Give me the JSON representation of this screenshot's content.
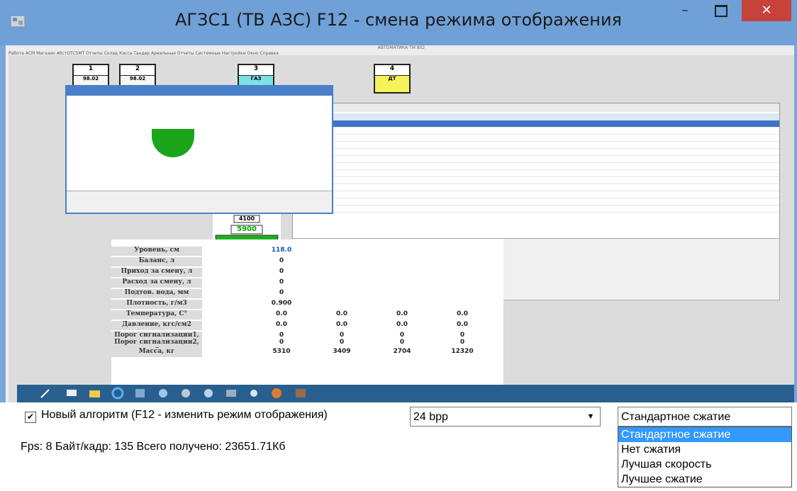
{
  "window": {
    "title": "АГЗС1 (ТВ АЗС) F12 - смена режима отображения",
    "minimize": "–",
    "close": "✕",
    "accent": "#6fa0d8",
    "close_color": "#c7423a"
  },
  "remote": {
    "app_title": "АВТОМАТИКА ТМ 802",
    "menu": "Работа АСМ Магазин АбстOTCSMT Отчеты Склад Касса Тандер Ареальные Отчеты Системные Настройки Окно Справка",
    "dispensers": [
      {
        "num": "1",
        "fuel": "98.02"
      },
      {
        "num": "2",
        "fuel": "98.02"
      },
      {
        "num": "3",
        "fuel": "ГАЗ"
      },
      {
        "num": "4",
        "fuel": "ДТ"
      }
    ],
    "grid_labels": [
      "Уровень, см",
      "Баланс, л",
      "Приход за смену, л",
      "Расход за смену, л",
      "Подтов. вода, мм",
      "Плотность, г/м3",
      "Температура, С°",
      "Давление, кгс/см2",
      "Порог сигнализации1, л",
      "Порог сигнализации2, л",
      "Масса, кг"
    ],
    "grid_col1": [
      "118.0",
      "0",
      "0",
      "0",
      "0",
      "0.900",
      "0.0",
      "0.0",
      "0",
      "0",
      "5310"
    ],
    "grid_col2": [
      "",
      "",
      "",
      "",
      "",
      "",
      "0.0",
      "0.0",
      "0",
      "0",
      "3409"
    ],
    "grid_col3": [
      "",
      "",
      "",
      "",
      "",
      "",
      "0.0",
      "0.0",
      "0",
      "0",
      "2704"
    ],
    "grid_col4": [
      "",
      "",
      "",
      "",
      "",
      "",
      "0.0",
      "0.0",
      "0",
      "0",
      "12320"
    ],
    "gauge_top": "4100",
    "gauge_value": "5900"
  },
  "controls": {
    "checkbox_label": "Новый алгоритм (F12 - изменить режим отображения)",
    "checked_mark": "✔",
    "bpp_value": "24 bpp",
    "compression_value": "Стандартное сжатие",
    "compression_options": [
      "Стандартное сжатие",
      "Нет сжатия",
      "Лучшая скорость",
      "Лучшее сжатие"
    ],
    "status": "Fps: 8   Байт/кадр: 135   Всего получено: 23651.71Кб",
    "selection_color": "#3399ff"
  }
}
